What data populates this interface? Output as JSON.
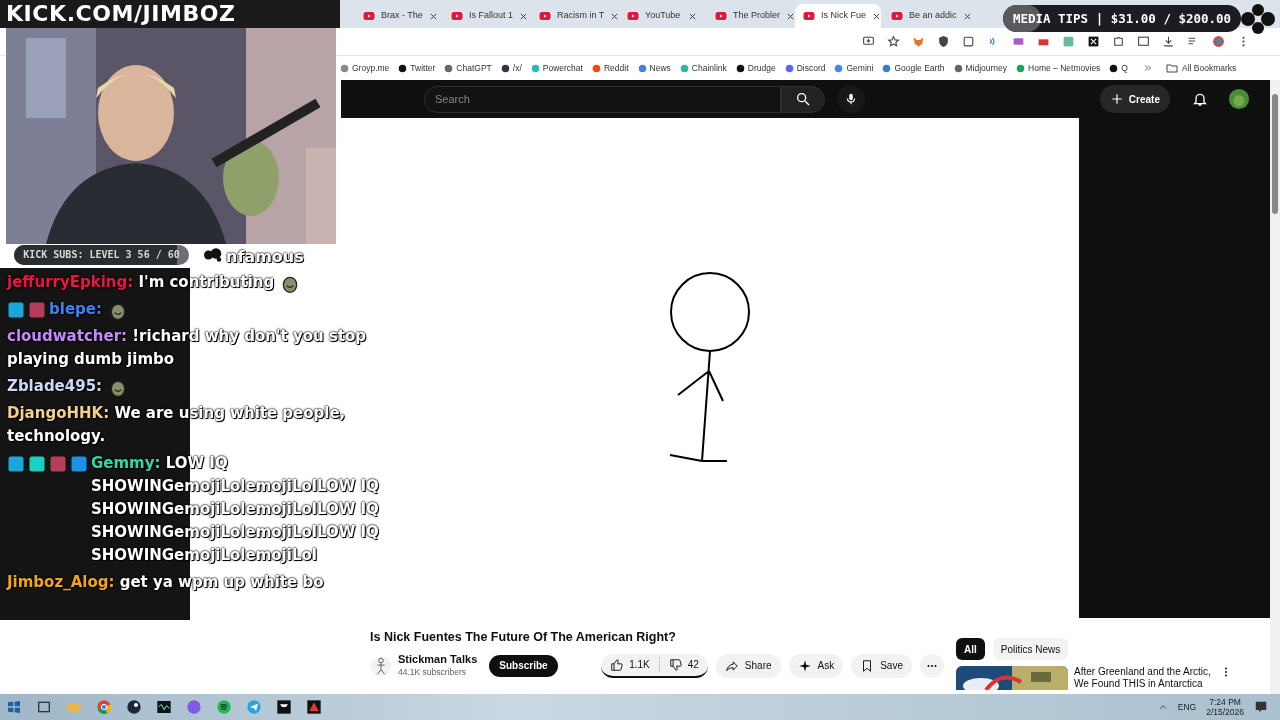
{
  "stream_overlay": {
    "logo": "KICK.COM/JIMBOZ",
    "media_tips": {
      "label": "MEDIA TIPS | $31.00 / $200.00",
      "level": 0.16
    },
    "kick_subs": {
      "label": "KICK SUBS: LEVEL 3 56 / 60",
      "level": 0.93
    },
    "chat": [
      {
        "kind": "fragment",
        "text": "nfamous"
      },
      {
        "kind": "message",
        "user": "jeffurryEpking:",
        "color": "#e8173f",
        "text": "I'm contributing",
        "emote": true
      },
      {
        "kind": "message",
        "user": "blepe:",
        "color": "#3b82f6",
        "badges": [
          {
            "color": "#1aa7d8"
          },
          {
            "color": "#b53c5a"
          }
        ],
        "emote": true
      },
      {
        "kind": "message",
        "user": "cloudwatcher:",
        "color": "#c58af9",
        "text": "!richard why don't you stop playing dumb jimbo"
      },
      {
        "kind": "message",
        "user": "Zblade495:",
        "color": "#c9dcf5",
        "emote": true
      },
      {
        "kind": "message",
        "user": "DjangoHHK:",
        "color": "#f4d08c",
        "text": "We are using white people, technology."
      },
      {
        "kind": "message",
        "user": "Gemmy:",
        "color": "#2fd9a6",
        "badges": [
          {
            "color": "#1aa7d8"
          },
          {
            "color": "#1ad0c0"
          },
          {
            "color": "#b53c5a"
          },
          {
            "color": "#1e90e8"
          }
        ],
        "text": "LOW IQ SHOWINGemojiLolemojiLolLOW IQ SHOWINGemojiLolemojiLolLOW IQ SHOWINGemojiLolemojiLolLOW IQ SHOWINGemojiLolemojiLol"
      },
      {
        "kind": "message",
        "user": "Jimboz_Alog:",
        "color": "#f2a516",
        "text": "get ya wpm up white bo"
      }
    ]
  },
  "browser": {
    "tabs": [
      {
        "title": "Brax - The",
        "selected": false
      },
      {
        "title": "Is Fallout 1",
        "selected": false
      },
      {
        "title": "Racism in T",
        "selected": false
      },
      {
        "title": "YouTube",
        "selected": false
      },
      {
        "title": "The Probler",
        "selected": false
      },
      {
        "title": "Is Nick Fue",
        "selected": true
      },
      {
        "title": "Be an addic",
        "selected": false
      }
    ],
    "bookmarks": [
      "Groyp.me",
      "Twitter",
      "ChatGPT",
      "/x/",
      "Powerchat",
      "Reddit",
      "News",
      "Chainlink",
      "Drudge",
      "Discord",
      "Gemini",
      "Google Earth",
      "Midjourney",
      "Home – Netmovies",
      "Q"
    ],
    "all_bookmarks": "All Bookmarks"
  },
  "youtube": {
    "search": {
      "placeholder": "Search"
    },
    "create": "Create",
    "video": {
      "title": "Is Nick Fuentes The Future Of The American Right?",
      "channel": "Stickman Talks",
      "subscribers": "44.1K subscribers",
      "subscribe": "Subscribe",
      "likes": "1.1K",
      "dislikes": "42",
      "actions": [
        "Share",
        "Ask",
        "Save"
      ]
    },
    "chips": [
      {
        "label": "All",
        "selected": true
      },
      {
        "label": "Politics News",
        "selected": false
      }
    ],
    "recommendations": [
      {
        "title": "After Greenland and the Arctic, We Found THIS in Antarctica"
      }
    ]
  },
  "taskbar": {
    "language": "ENG",
    "time": "7:24 PM",
    "date": "2/15/2026"
  }
}
